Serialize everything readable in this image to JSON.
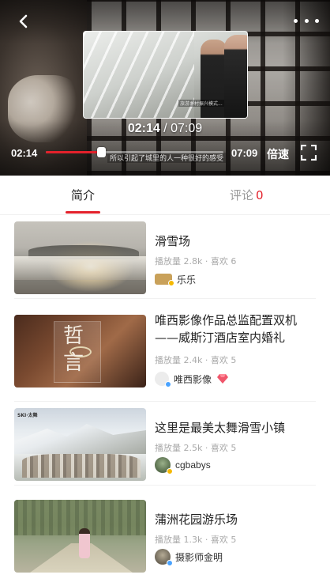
{
  "player": {
    "current_time": "02:14",
    "total_time": "07:09",
    "center_current": "02:14",
    "center_separator": " / ",
    "center_total": "07:09",
    "progress_fraction": 0.313,
    "speed_label": "倍速",
    "subtitle": "所以引起了城里的人一种很好的感受",
    "preview_caption": "旅游乡村振兴模式...",
    "icons": {
      "back": "chevron-left-icon",
      "more": "more-dots-icon",
      "fullscreen": "fullscreen-icon"
    },
    "accent_color": "#e3212b"
  },
  "tabs": {
    "intro_label": "简介",
    "comment_label": "评论",
    "comment_count": "0"
  },
  "list": [
    {
      "title": "滑雪场",
      "meta": "播放量 2.8k · 喜欢 6",
      "author": "乐乐",
      "badge_color": "#f5b800",
      "avatar_color": "#c9a15a"
    },
    {
      "title": "唯西影像作品总监配置双机——威斯汀酒店室内婚礼",
      "meta": "播放量 2.4k · 喜欢 5",
      "author": "唯西影像",
      "badge_color": "#4aa3ff",
      "avatar_color": "#e8e8e8",
      "vip_icon": "diamond-icon"
    },
    {
      "title": "这里是最美太舞滑雪小镇",
      "meta": "播放量 2.5k · 喜欢 5",
      "author": "cgbabys",
      "badge_color": "#f5b800",
      "avatar_color": "#556b4a"
    },
    {
      "title": "蒲洲花园游乐场",
      "meta": "播放量 1.3k · 喜欢 5",
      "author": "摄影师金明",
      "badge_color": "#4aa3ff",
      "avatar_color": "#6b6456"
    }
  ]
}
